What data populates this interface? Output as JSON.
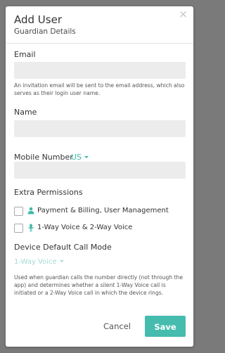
{
  "header": {
    "title": "Add User",
    "subtitle": "Guardian Details",
    "close_icon": "close-icon",
    "close_glyph": "×"
  },
  "email": {
    "label": "Email",
    "value": "",
    "help": "An invitation email will be sent to the email address, which also serves as their login user name."
  },
  "name": {
    "label": "Name",
    "value": ""
  },
  "mobile": {
    "label": "Mobile Number",
    "country": "US",
    "value": ""
  },
  "permissions": {
    "label": "Extra Permissions",
    "items": [
      {
        "label": "Payment & Billing, User Management",
        "checked": false,
        "icon": "user-icon"
      },
      {
        "label": "1-Way Voice & 2-Way Voice",
        "checked": false,
        "icon": "microphone-icon"
      }
    ]
  },
  "call_mode": {
    "label": "Device Default Call Mode",
    "selected": "1-Way Voice",
    "help": "Used when guardian calls the number directly (not through the app) and determines whether a silent 1-Way Voice call is initiated or a 2-Way Voice call in which the device rings."
  },
  "footer": {
    "cancel_label": "Cancel",
    "save_label": "Save"
  },
  "colors": {
    "accent": "#45bcae",
    "accent_light": "#a5dcd5",
    "input_bg": "#ececec",
    "backdrop": "#7a7a7a"
  }
}
